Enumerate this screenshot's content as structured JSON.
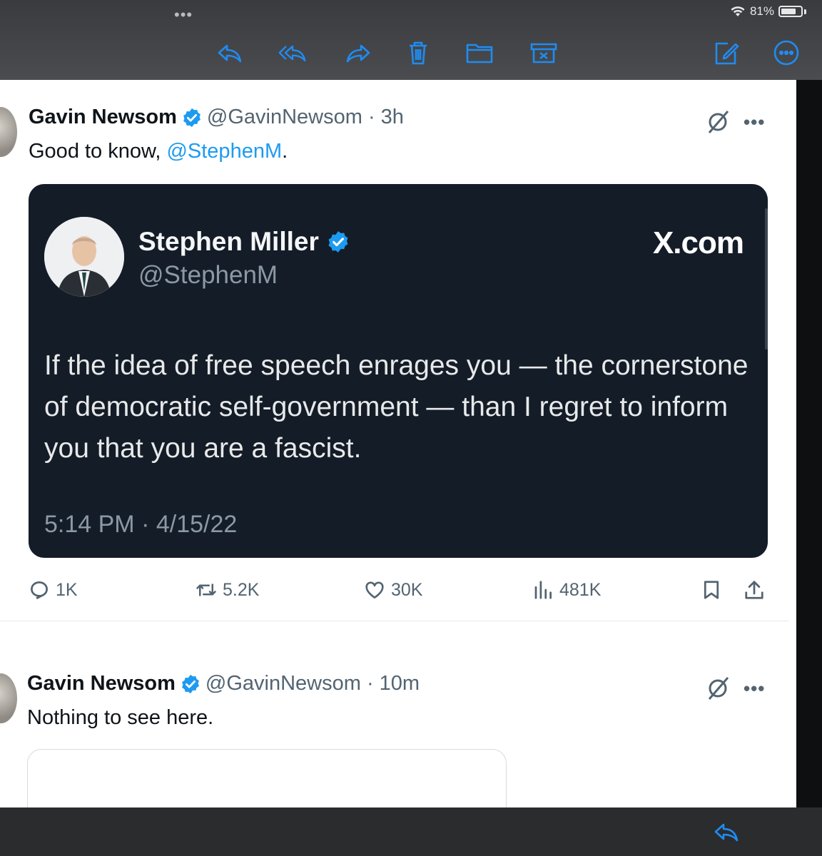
{
  "status_bar": {
    "dots": "•••",
    "battery": "81%",
    "battery_level": 0.81
  },
  "toolbar": {
    "accent": "#1f8cf2",
    "icons": [
      "reply-icon",
      "reply-all-icon",
      "forward-icon",
      "trash-icon",
      "folder-icon",
      "archive-icon",
      "compose-icon",
      "more-circle-icon"
    ]
  },
  "tweets": [
    {
      "name": "Gavin Newsom",
      "handle": "@GavinNewsom · 3h",
      "text_prefix": "Good to know, ",
      "mention": "@StephenM",
      "text_suffix": ".",
      "more": "•••",
      "quoted": {
        "name": "Stephen Miller",
        "handle": "@StephenM",
        "brand": "X.com",
        "body": "If the idea of free speech enrages you — the cornerstone of democratic self-government — than I regret to inform you that you are a fascist.",
        "time": "5:14 PM · 4/15/22"
      },
      "stats": {
        "replies": "1K",
        "reposts": "5.2K",
        "likes": "30K",
        "views": "481K"
      }
    },
    {
      "name": "Gavin Newsom",
      "handle": "@GavinNewsom · 10m",
      "text": "Nothing to see here.",
      "more": "•••"
    }
  ],
  "colors": {
    "link": "#1d9bf0",
    "verified": "#1d9bf0",
    "card_bg": "#141c27"
  }
}
